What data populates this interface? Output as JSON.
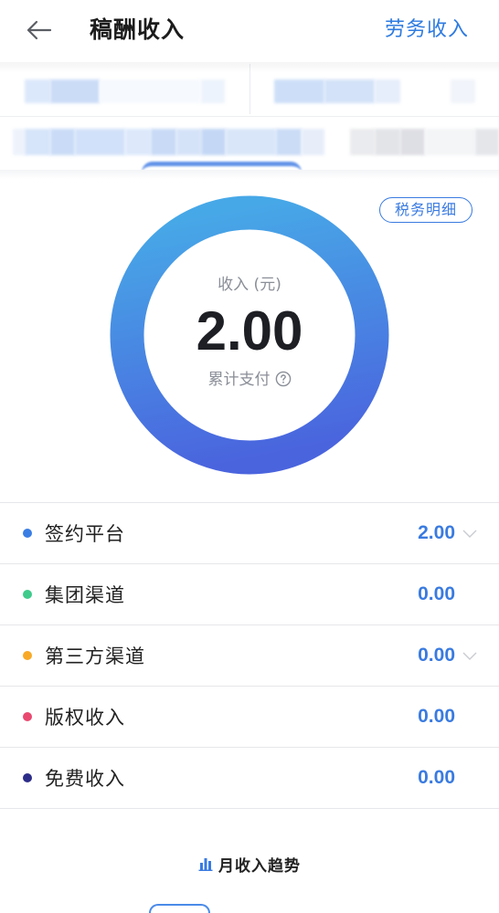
{
  "header": {
    "back_icon": "arrow-left-icon",
    "title": "稿酬收入",
    "right_link": "劳务收入"
  },
  "summary": {
    "tax_detail_button": "税务明细",
    "income_label": "收入 (元)",
    "total": "2.00",
    "cumulative_label": "累计支付",
    "help_icon": "question-circle-icon",
    "ring_gradient": {
      "top": "#47A8E7",
      "bottom": "#4A64DE"
    }
  },
  "breakdown": [
    {
      "label": "签约平台",
      "value": "2.00",
      "dot_color": "#3A7EE4",
      "expand_icon": "chevron-down-icon"
    },
    {
      "label": "集团渠道",
      "value": "0.00",
      "dot_color": "#3ECB8C"
    },
    {
      "label": "第三方渠道",
      "value": "0.00",
      "dot_color": "#F8A926",
      "expand_icon": "chevron-down-icon"
    },
    {
      "label": "版权收入",
      "value": "0.00",
      "dot_color": "#E9486F"
    },
    {
      "label": "免费收入",
      "value": "0.00",
      "dot_color": "#2C2D88"
    }
  ],
  "trend": {
    "icon": "bar-chart-icon",
    "title": "月收入趋势"
  },
  "colors": {
    "accent": "#3A7BE0",
    "divider": "#E6E7EA"
  }
}
